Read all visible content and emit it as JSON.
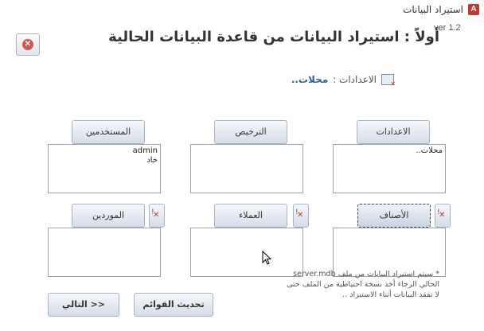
{
  "window": {
    "title": "استيراد البيانات",
    "app_icon": "A"
  },
  "version": "ver 1.2",
  "heading": "أولاً : استيراد البيانات من قاعدة البيانات الحالية",
  "settings": {
    "label": "الاعدادات :",
    "value": "محلات.."
  },
  "columns": {
    "settings": {
      "label": "الاعدادات",
      "items": [
        "محلات.."
      ]
    },
    "license": {
      "label": "الترخيص",
      "items": []
    },
    "users": {
      "label": "المستخدمين",
      "items": [
        "admin",
        "خاد"
      ]
    },
    "categories": {
      "label": "الأصناف",
      "items": []
    },
    "customers": {
      "label": "العملاء",
      "items": []
    },
    "suppliers": {
      "label": "الموردين",
      "items": []
    }
  },
  "buttons": {
    "refresh": "تحديث القوائم",
    "next": "التالي >>"
  },
  "note": "* سيتم استيراد البيانات من ملف server.mdb الحالي الرجاء أخذ نسخة احتياطية من الملف حتى لا تفقد البيانات أثناء الاستيراد ..",
  "colors": {
    "accent": "#2e5f9e",
    "danger": "#d9534f"
  }
}
